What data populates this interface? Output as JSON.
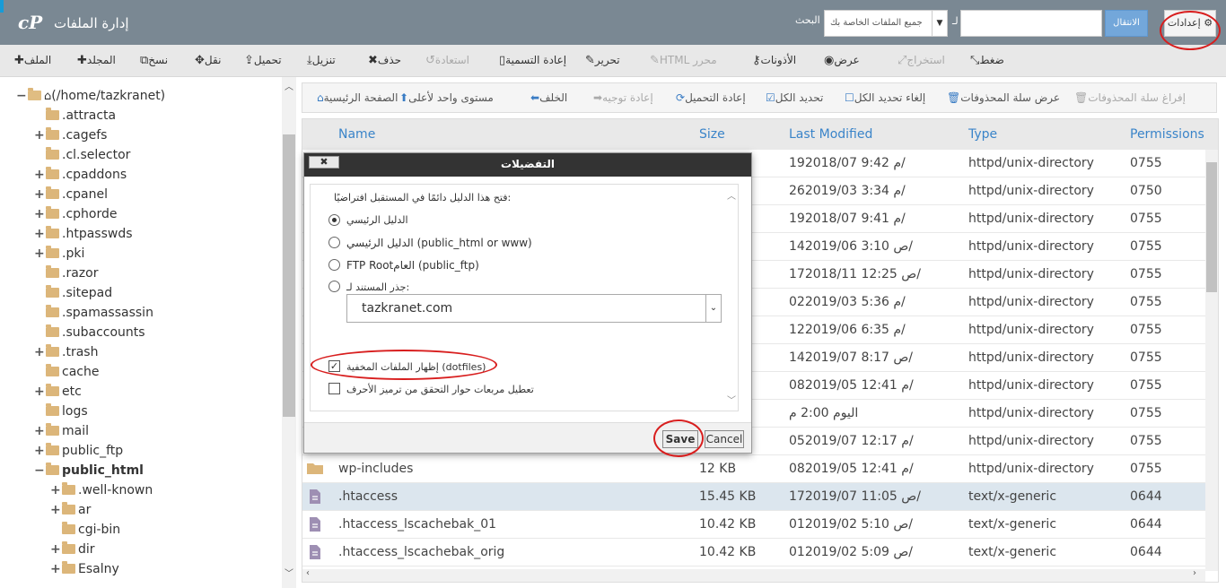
{
  "header": {
    "logo": "cP",
    "title": "إدارة الملفات",
    "search_label": "البحث",
    "search_scope": "جميع الملفات الخاصة بك",
    "search_for": "لـ",
    "go_label": "الانتقال",
    "settings_label": "إعدادات"
  },
  "toolbar": [
    {
      "label": "الملف",
      "icon": "plus-icon",
      "disabled": false
    },
    {
      "label": "المجلد",
      "icon": "plus-icon",
      "disabled": false
    },
    {
      "label": "نسخ",
      "icon": "copy-icon",
      "disabled": false
    },
    {
      "label": "نقل",
      "icon": "move-icon",
      "disabled": false
    },
    {
      "label": "تحميل",
      "icon": "upload-icon",
      "disabled": false
    },
    {
      "label": "تنزيل",
      "icon": "download-icon",
      "disabled": false
    },
    {
      "label": "حذف",
      "icon": "delete-icon",
      "disabled": false
    },
    {
      "label": "استعادة",
      "icon": "restore-icon",
      "disabled": true
    },
    {
      "label": "إعادة التسمية",
      "icon": "rename-icon",
      "disabled": false
    },
    {
      "label": "تحرير",
      "icon": "edit-icon",
      "disabled": false
    },
    {
      "label": "HTML محرر",
      "icon": "html-editor-icon",
      "disabled": true
    },
    {
      "label": "الأذونات",
      "icon": "key-icon",
      "disabled": false
    },
    {
      "label": "عرض",
      "icon": "eye-icon",
      "disabled": false
    },
    {
      "label": "استخراج",
      "icon": "extract-icon",
      "disabled": true
    },
    {
      "label": "ضغط",
      "icon": "compress-icon",
      "disabled": false
    }
  ],
  "tree": {
    "root": "(/home/tazkranet)",
    "items": [
      {
        "label": ".attracta",
        "expand": ""
      },
      {
        "label": ".cagefs",
        "expand": "+"
      },
      {
        "label": ".cl.selector",
        "expand": ""
      },
      {
        "label": ".cpaddons",
        "expand": "+"
      },
      {
        "label": ".cpanel",
        "expand": "+"
      },
      {
        "label": ".cphorde",
        "expand": "+"
      },
      {
        "label": ".htpasswds",
        "expand": "+"
      },
      {
        "label": ".pki",
        "expand": "+"
      },
      {
        "label": ".razor",
        "expand": ""
      },
      {
        "label": ".sitepad",
        "expand": ""
      },
      {
        "label": ".spamassassin",
        "expand": ""
      },
      {
        "label": ".subaccounts",
        "expand": ""
      },
      {
        "label": ".trash",
        "expand": "+"
      },
      {
        "label": "cache",
        "expand": ""
      },
      {
        "label": "etc",
        "expand": "+"
      },
      {
        "label": "logs",
        "expand": ""
      },
      {
        "label": "mail",
        "expand": "+"
      },
      {
        "label": "public_ftp",
        "expand": "+"
      },
      {
        "label": "public_html",
        "expand": "−"
      }
    ],
    "children": [
      {
        "label": ".well-known",
        "expand": "+"
      },
      {
        "label": "ar",
        "expand": "+"
      },
      {
        "label": "cgi-bin",
        "expand": ""
      },
      {
        "label": "dir",
        "expand": "+"
      },
      {
        "label": "Esalny",
        "expand": "+"
      }
    ]
  },
  "nav": [
    {
      "label": "الصفحة الرئيسية",
      "icon": "home-icon",
      "disabled": false
    },
    {
      "label": "مستوى واحد لأعلى",
      "icon": "up-arrow-icon",
      "disabled": false
    },
    {
      "label": "الخلف",
      "icon": "back-arrow-icon",
      "disabled": false
    },
    {
      "label": "إعادة توجيه",
      "icon": "forward-arrow-icon",
      "disabled": true
    },
    {
      "label": "إعادة التحميل",
      "icon": "reload-icon",
      "disabled": false
    },
    {
      "label": "تحديد الكل",
      "icon": "check-all-icon",
      "disabled": false
    },
    {
      "label": "إلغاء تحديد الكل",
      "icon": "uncheck-icon",
      "disabled": false
    },
    {
      "label": "عرض سلة المحذوفات",
      "icon": "trash-icon",
      "disabled": false
    },
    {
      "label": "إفراغ سلة المحذوفات",
      "icon": "trash-icon",
      "disabled": true
    }
  ],
  "table": {
    "headers": [
      "Name",
      "Size",
      "Last Modified",
      "Type",
      "Permissions"
    ],
    "rows": [
      {
        "type": "dir",
        "name": "",
        "size": "",
        "modified": "19م 9:42 2018/07/",
        "mime": "httpd/unix-directory",
        "perm": "0755"
      },
      {
        "type": "dir",
        "name": "",
        "size": "",
        "modified": "26م 3:34 2019/03/",
        "mime": "httpd/unix-directory",
        "perm": "0750"
      },
      {
        "type": "dir",
        "name": "",
        "size": "",
        "modified": "19م 9:41 2018/07/",
        "mime": "httpd/unix-directory",
        "perm": "0755"
      },
      {
        "type": "dir",
        "name": "",
        "size": "",
        "modified": "14ص 3:10 2019/06/",
        "mime": "httpd/unix-directory",
        "perm": "0755"
      },
      {
        "type": "dir",
        "name": "",
        "size": "",
        "modified": "17ص 12:25 2018/11/",
        "mime": "httpd/unix-directory",
        "perm": "0755"
      },
      {
        "type": "dir",
        "name": "",
        "size": "",
        "modified": "02م 5:36 2019/03/",
        "mime": "httpd/unix-directory",
        "perm": "0755"
      },
      {
        "type": "dir",
        "name": "",
        "size": "",
        "modified": "12م 6:35 2019/06/",
        "mime": "httpd/unix-directory",
        "perm": "0755"
      },
      {
        "type": "dir",
        "name": "",
        "size": "",
        "modified": "14ص 8:17 2019/07/",
        "mime": "httpd/unix-directory",
        "perm": "0755"
      },
      {
        "type": "dir",
        "name": "",
        "size": "",
        "modified": "08م 12:41 2019/05/",
        "mime": "httpd/unix-directory",
        "perm": "0755"
      },
      {
        "type": "dir",
        "name": "",
        "size": "",
        "modified": "اليوم 2:00 م",
        "mime": "httpd/unix-directory",
        "perm": "0755"
      },
      {
        "type": "dir",
        "name": "",
        "size": "",
        "modified": "05م 12:17 2019/07/",
        "mime": "httpd/unix-directory",
        "perm": "0755"
      },
      {
        "type": "dir",
        "name": "wp-includes",
        "size": "12 KB",
        "modified": "08م 12:41 2019/05/",
        "mime": "httpd/unix-directory",
        "perm": "0755"
      },
      {
        "type": "file",
        "name": ".htaccess",
        "size": "15.45 KB",
        "modified": "17ص 11:05 2019/07/",
        "mime": "text/x-generic",
        "perm": "0644",
        "selected": true
      },
      {
        "type": "file",
        "name": ".htaccess_lscachebak_01",
        "size": "10.42 KB",
        "modified": "01ص 5:10 2019/02/",
        "mime": "text/x-generic",
        "perm": "0644"
      },
      {
        "type": "file",
        "name": ".htaccess_lscachebak_orig",
        "size": "10.42 KB",
        "modified": "01ص 5:09 2019/02/",
        "mime": "text/x-generic",
        "perm": "0644"
      }
    ]
  },
  "modal": {
    "title": "التفضيلات",
    "close_label": "✖",
    "default_dir_label": "فتح هذا الدليل دائمًا في المستقبل افتراضيًا:",
    "options": [
      {
        "label": "الدليل الرئيسي",
        "selected": true
      },
      {
        "label": "الدليل الرئيسي (public_html or www)",
        "selected": false
      },
      {
        "label": "FTP Rootالعام (public_ftp)",
        "selected": false
      },
      {
        "label": "جذر المستند لـ:",
        "selected": false
      }
    ],
    "domain_value": "tazkranet.com",
    "show_hidden_label": "إظهار الملفات المخفية (dotfiles)",
    "show_hidden_checked": true,
    "disable_charset_label": "تعطيل مربعات حوار التحقق من ترميز الأحرف",
    "disable_charset_checked": false,
    "save_label": "Save",
    "cancel_label": "Cancel"
  },
  "colors": {
    "header_bg": "#7a8893",
    "accent": "#3a84c9",
    "annotation": "#d81e1e"
  }
}
